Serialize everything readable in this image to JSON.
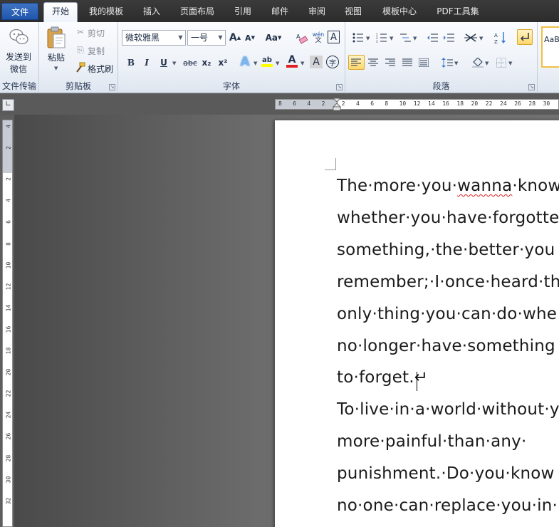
{
  "tabs": [
    {
      "label": "文件",
      "kind": "file"
    },
    {
      "label": "开始",
      "kind": "active"
    },
    {
      "label": "我的模板",
      "kind": "normal"
    },
    {
      "label": "插入",
      "kind": "normal"
    },
    {
      "label": "页面布局",
      "kind": "normal"
    },
    {
      "label": "引用",
      "kind": "normal"
    },
    {
      "label": "邮件",
      "kind": "normal"
    },
    {
      "label": "审阅",
      "kind": "normal"
    },
    {
      "label": "视图",
      "kind": "normal"
    },
    {
      "label": "模板中心",
      "kind": "normal"
    },
    {
      "label": "PDF工具集",
      "kind": "normal"
    }
  ],
  "ribbon": {
    "file_transfer": {
      "group_label": "文件传输",
      "send_label_line1": "发送到",
      "send_label_line2": "微信",
      "icon": "wechat-icon"
    },
    "clipboard": {
      "group_label": "剪贴板",
      "paste_label": "粘贴",
      "cut_label": "剪切",
      "copy_label": "复制",
      "format_painter_label": "格式刷"
    },
    "font": {
      "group_label": "字体",
      "font_name": "微软雅黑",
      "font_size": "一号",
      "grow_label": "A",
      "shrink_label": "A",
      "change_case_label": "Aa",
      "phonetic_label": "wén",
      "bold": "B",
      "italic": "I",
      "underline": "U",
      "strikethrough": "abc",
      "subscript": "x₂",
      "superscript": "x²",
      "text_effects": "A",
      "highlight": "ab",
      "font_color": "A",
      "char_shading": "A",
      "enclose": "字",
      "highlight_color": "#ffff00",
      "font_color_value": "#e02020"
    },
    "paragraph": {
      "group_label": "段落"
    },
    "styles": {
      "preview": "AaB"
    }
  },
  "ruler": {
    "h_numbers": [
      "8",
      "6",
      "4",
      "2",
      "2",
      "4",
      "6",
      "8",
      "10",
      "12",
      "14",
      "16",
      "18",
      "20",
      "22",
      "24",
      "26",
      "28",
      "30"
    ],
    "v_numbers": [
      "4",
      "2",
      "2",
      "4",
      "6",
      "8",
      "10",
      "12",
      "14",
      "16",
      "18",
      "20",
      "22",
      "24",
      "26",
      "28",
      "30",
      "32"
    ]
  },
  "document": {
    "lines": [
      "The·more·you·wanna·know",
      "whether·you·have·forgotte",
      "something,·the·better·you",
      "remember;·I·once·heard·th",
      "only·thing·you·can·do·whe",
      "no·longer·have·something",
      "to·forget.↵",
      "To·live·in·a·world·without·y",
      "more·painful·than·any·",
      "punishment.·Do·you·know",
      "no·one·can·replace·you·in·"
    ],
    "misspelled_word": "wanna"
  }
}
